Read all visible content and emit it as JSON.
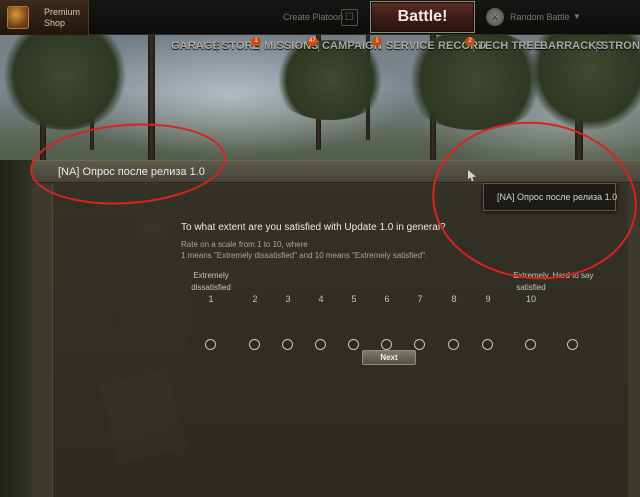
{
  "topbar": {
    "premium_shop_label": "Premium Shop",
    "create_platoon_label": "Create Platoon",
    "battle_label": "Battle!",
    "battle_mode_label": "Random Battle"
  },
  "nav": {
    "items": [
      {
        "label": "GARAGE"
      },
      {
        "label": "STORE",
        "badge": "1"
      },
      {
        "label": "MISSIONS",
        "badge": "47"
      },
      {
        "label": "CAMPAIGN",
        "badge": "1"
      },
      {
        "label": "SERVICE RECORD",
        "badge": "2"
      },
      {
        "label": "TECH TREE"
      },
      {
        "label": "BARRACKS"
      },
      {
        "label": "STRONG"
      }
    ]
  },
  "survey": {
    "window_title": "[NA] Опрос после релиза 1.0",
    "tooltip_text": "[NA] Опрос после релиза 1.0",
    "question": "To what extent are you satisfied with Update 1.0 in general?",
    "hint_lines": [
      "Rate on a scale from 1 to 10, where",
      "1 means \"Extremely dissatisfied\" and 10 means \"Extremely satisfied\"."
    ],
    "low_label": "Extremely dissatisfied",
    "high_label": "Extremely satisfied",
    "hard_label": "Hard to say",
    "scale": [
      "1",
      "2",
      "3",
      "4",
      "5",
      "6",
      "7",
      "8",
      "9",
      "10"
    ],
    "next_label": "Next"
  },
  "colors": {
    "annotation": "#d8231f",
    "badge": "#cc4a14",
    "battle_button": "#4a231c"
  }
}
